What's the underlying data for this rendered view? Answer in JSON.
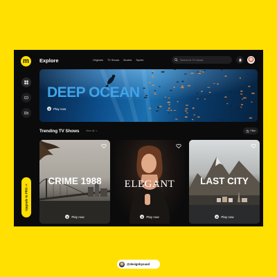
{
  "header": {
    "logo_letter": "m",
    "title": "Explore",
    "nav": [
      "Originals",
      "TV Shows",
      "Movies",
      "Sports"
    ],
    "search_placeholder": "Search for TV shows"
  },
  "sidebar": {
    "upgrade_label": "Upgrade to PRO ->"
  },
  "hero": {
    "title": "DEEP OCEAN",
    "play_label": "Play now"
  },
  "section": {
    "title": "Trending TV Shows",
    "view_all": "View all ->",
    "filter_label": "Filter"
  },
  "cards": [
    {
      "title": "CRIME 1988",
      "play_label": "Play now"
    },
    {
      "title": "ELEGANT",
      "play_label": "Play now"
    },
    {
      "title": "LAST CITY",
      "play_label": "Play now"
    }
  ],
  "footer": {
    "handle": "@designbysaud"
  },
  "colors": {
    "accent": "#FFE000",
    "panel": "#0b0b0c",
    "hero_text": "#3fa5ea"
  }
}
